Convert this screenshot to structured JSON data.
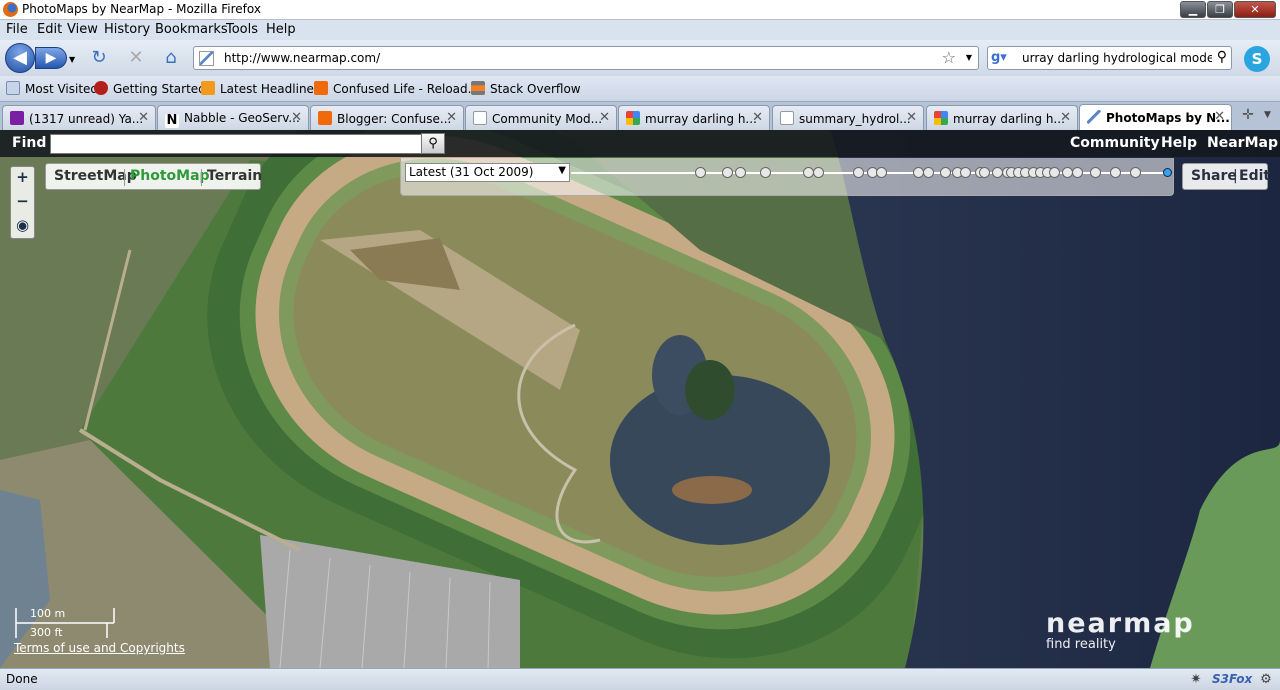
{
  "window": {
    "title": "PhotoMaps by NearMap - Mozilla Firefox"
  },
  "menu": [
    "File",
    "Edit",
    "View",
    "History",
    "Bookmarks",
    "Tools",
    "Help"
  ],
  "nav": {
    "url": "http://www.nearmap.com/",
    "search_query": "urray darling hydrological modelling"
  },
  "bookmarks": [
    "Most Visited",
    "Getting Started",
    "Latest Headlines",
    "Confused Life - Reload...",
    "Stack Overflow"
  ],
  "tabs": [
    {
      "label": "(1317 unread) Ya...",
      "icon": "yahoo-icon",
      "selected": false
    },
    {
      "label": "Nabble - GeoServ...",
      "icon": "nabble-icon",
      "selected": false
    },
    {
      "label": "Blogger: Confuse...",
      "icon": "blogger-icon",
      "selected": false
    },
    {
      "label": "Community Mod...",
      "icon": "page-icon",
      "selected": false
    },
    {
      "label": "murray darling h...",
      "icon": "google-icon",
      "selected": false
    },
    {
      "label": "summary_hydrol...",
      "icon": "page-icon",
      "selected": false
    },
    {
      "label": "murray darling h...",
      "icon": "google-icon",
      "selected": false
    },
    {
      "label": "PhotoMaps by N...",
      "icon": "nearmap-icon",
      "selected": true
    }
  ],
  "map": {
    "find_label": "Find",
    "find_value": "",
    "top_links": [
      "Community",
      "Help",
      "NearMap"
    ],
    "map_types": [
      "StreetMap",
      "PhotoMap",
      "Terrain"
    ],
    "active_map_type": "PhotoMap",
    "date_selected": "Latest (31 Oct 2009)",
    "share_label": "Share",
    "edit_label": "Edit",
    "scale_metric": "100 m",
    "scale_imperial": "300 ft",
    "terms": "Terms of use and Copyrights",
    "logo_name": "nearmap",
    "logo_tagline": "find reality"
  },
  "status": {
    "text": "Done",
    "addon": "S3Fox"
  },
  "colors": {
    "accent_active": "#2e9a3a",
    "timeline_current": "#36a3e8"
  }
}
